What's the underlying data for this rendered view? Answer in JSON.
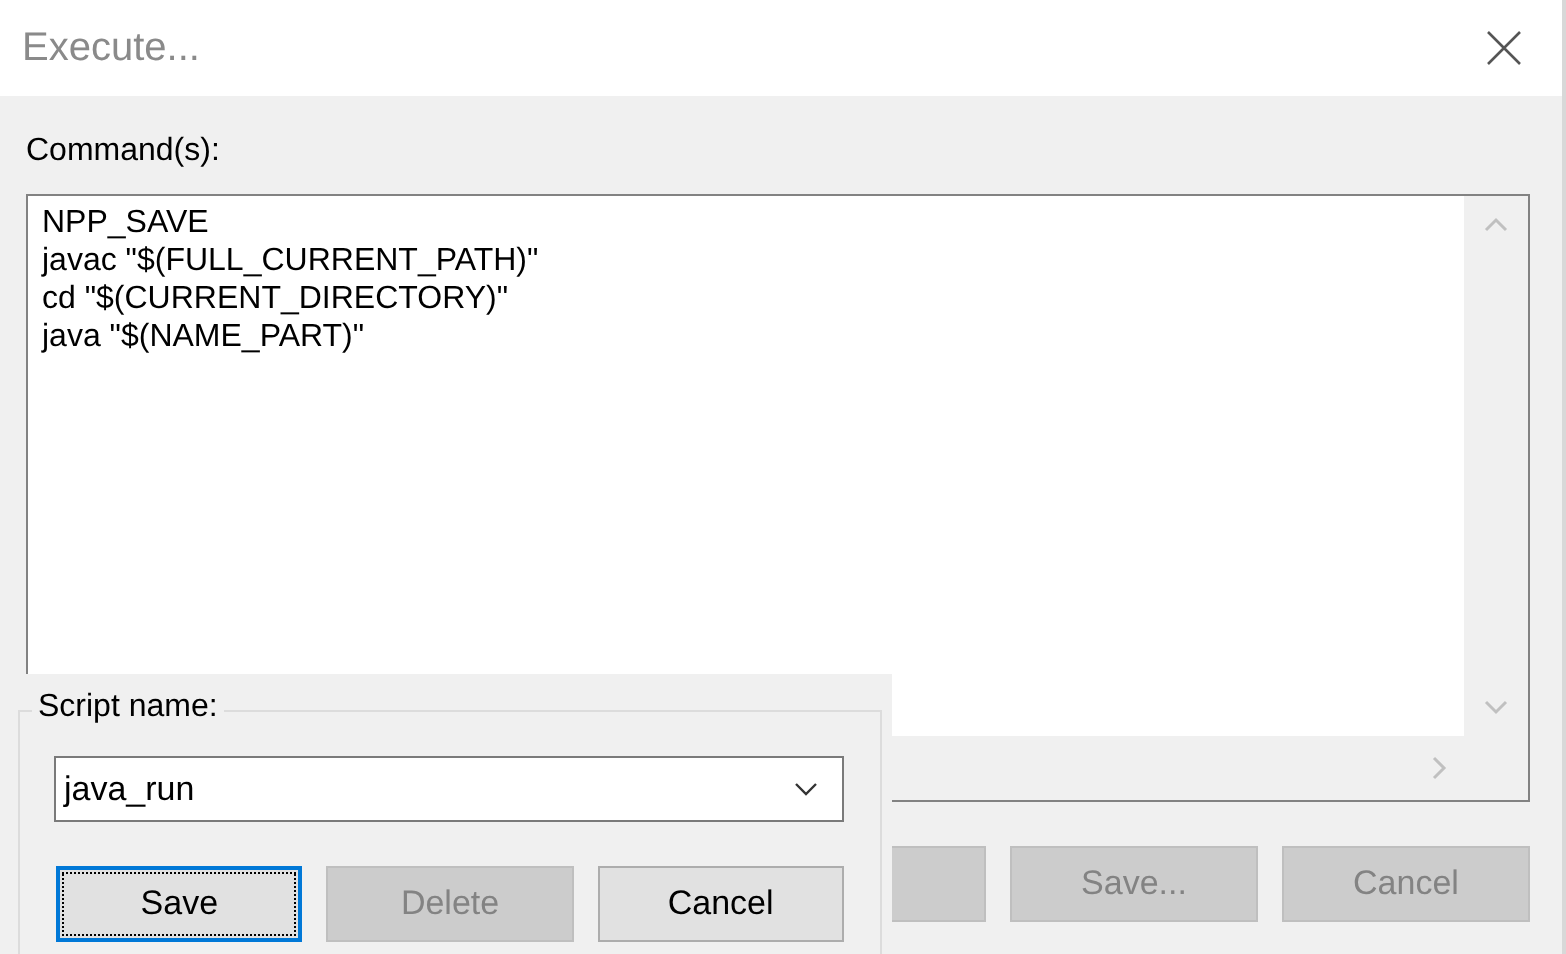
{
  "window": {
    "title": "Execute..."
  },
  "commands": {
    "label": "Command(s):",
    "lines": [
      "NPP_SAVE",
      "javac \"$(FULL_CURRENT_PATH)\"",
      "cd \"$(CURRENT_DIRECTORY)\"",
      "java \"$(NAME_PART)\""
    ]
  },
  "buttons": [
    {
      "label": "Save...",
      "disabled": true
    },
    {
      "label": "Cancel",
      "disabled": true
    }
  ],
  "save_dialog": {
    "group_label": "Script name:",
    "script_name": "java_run",
    "buttons": [
      {
        "label": "Save",
        "disabled": false,
        "focused": true
      },
      {
        "label": "Delete",
        "disabled": true,
        "focused": false
      },
      {
        "label": "Cancel",
        "disabled": false,
        "focused": false
      }
    ]
  }
}
